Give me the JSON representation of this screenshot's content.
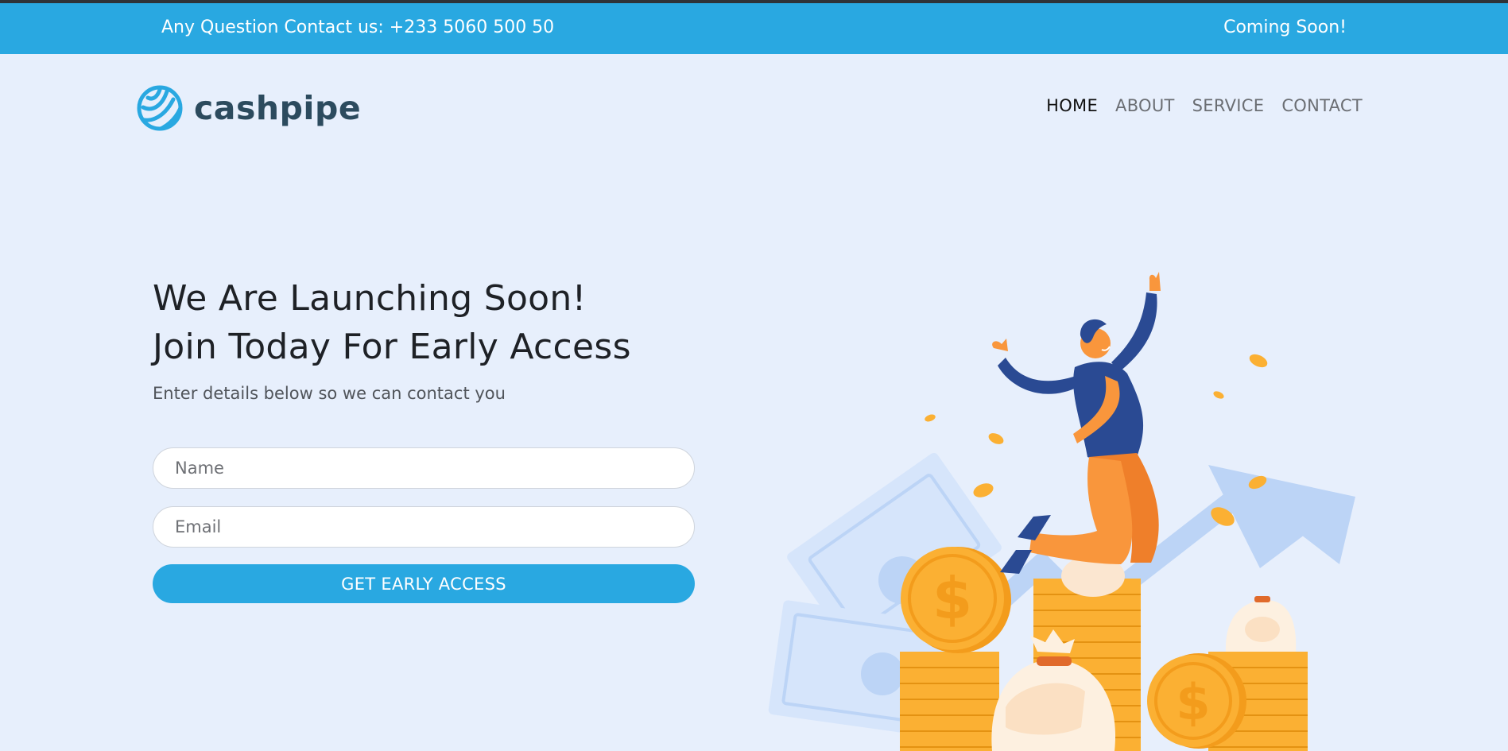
{
  "topbar": {
    "contact": "Any Question Contact us: +233 5060 500 50",
    "status": "Coming Soon!"
  },
  "brand": {
    "name": "cashpipe",
    "logo_icon": "striped-globe-icon"
  },
  "nav": {
    "items": [
      {
        "label": "HOME",
        "active": true
      },
      {
        "label": "ABOUT",
        "active": false
      },
      {
        "label": "SERVICE",
        "active": false
      },
      {
        "label": "CONTACT",
        "active": false
      }
    ]
  },
  "hero": {
    "title_line1": "We Are Launching Soon!",
    "title_line2": "Join Today For Early Access",
    "subtitle": "Enter details below so we can contact you"
  },
  "form": {
    "name_placeholder": "Name",
    "email_placeholder": "Email",
    "name_value": "",
    "email_value": "",
    "submit_label": "GET EARLY ACCESS"
  },
  "illustration": {
    "icon": "celebrating-man-on-coin-stacks-illustration",
    "currency_symbol": "$"
  },
  "colors": {
    "accent": "#29a8e1",
    "page_background": "#e7effc",
    "logo_text": "#2c4b5e",
    "coin": "#fbb033",
    "shirt": "#2a4a93",
    "pants": "#f9963c"
  }
}
